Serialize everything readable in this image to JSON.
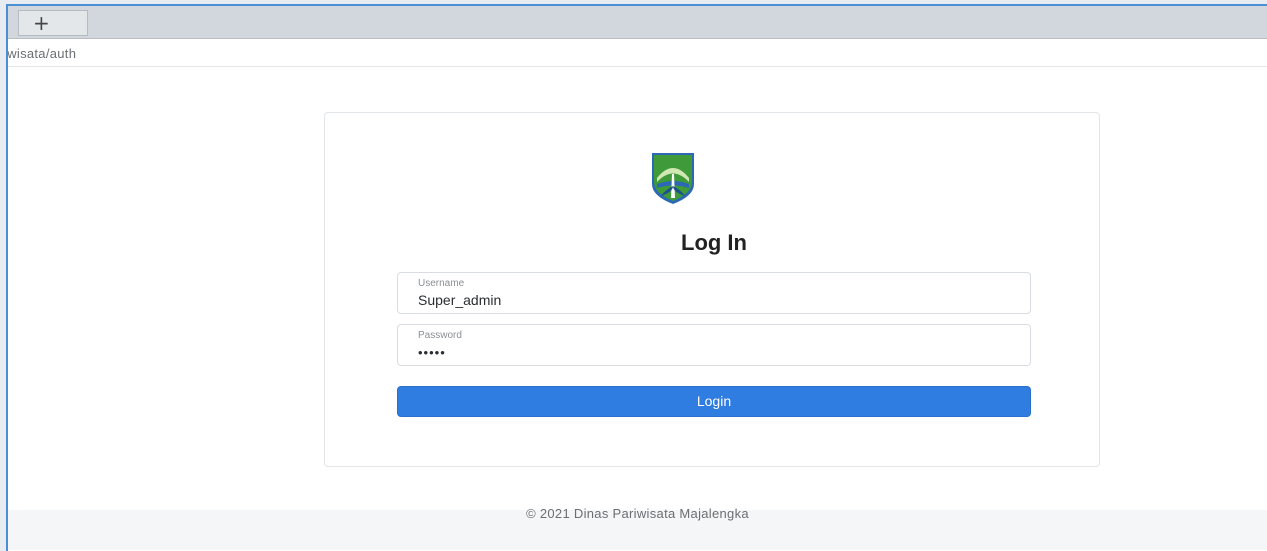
{
  "browser": {
    "new_tab_symbol": "+",
    "url": "iwisata/auth"
  },
  "login": {
    "title": "Log In",
    "username": {
      "label": "Username",
      "value": "Super_admin"
    },
    "password": {
      "label": "Password",
      "value": "•••••"
    },
    "submit_label": "Login"
  },
  "footer": {
    "text": "© 2021 Dinas Pariwisata Majalengka"
  },
  "colors": {
    "accent": "#2f7de1",
    "logo_green": "#3f9a3a",
    "logo_blue": "#2c68b5"
  },
  "icons": {
    "logo": "majalengka-crest-icon",
    "new_tab": "plus-icon"
  }
}
